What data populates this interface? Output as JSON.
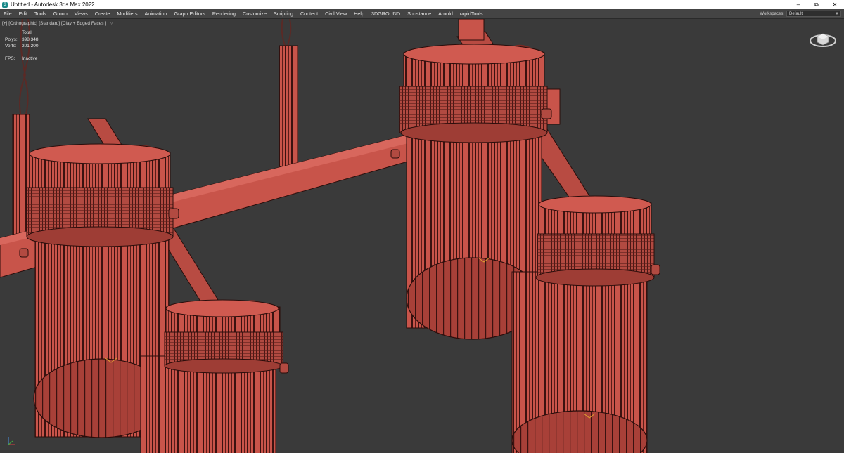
{
  "window": {
    "title": "Untitled - Autodesk 3ds Max 2022"
  },
  "menubar": {
    "items": [
      "File",
      "Edit",
      "Tools",
      "Group",
      "Views",
      "Create",
      "Modifiers",
      "Animation",
      "Graph Editors",
      "Rendering",
      "Customize",
      "Scripting",
      "Content",
      "Civil View",
      "Help",
      "3DGROUND",
      "Substance",
      "Arnold",
      "rapidTools"
    ],
    "workspace_label": "Workspaces:",
    "workspace_value": "Default"
  },
  "viewport": {
    "label": "[+] [Orthographic] [Standard] [Clay + Edged Faces ]",
    "stats": {
      "header": "Total",
      "polys_label": "Polys:",
      "polys_value": "398 348",
      "verts_label": "Verts:",
      "verts_value": "201 200",
      "fps_label": "FPS:",
      "fps_value": "Inactive"
    }
  },
  "colors": {
    "clay": "#c8544a",
    "clay_dark": "#7a2a24",
    "wire": "#2a0d0b",
    "viewport_bg": "#3a3a3a",
    "menubar_bg": "#444444"
  },
  "icons": [
    "app-icon",
    "minimize-icon",
    "maximize-icon",
    "close-icon",
    "filter-icon",
    "viewcube-icon",
    "axis-tripod-icon",
    "chevron-down-icon"
  ]
}
